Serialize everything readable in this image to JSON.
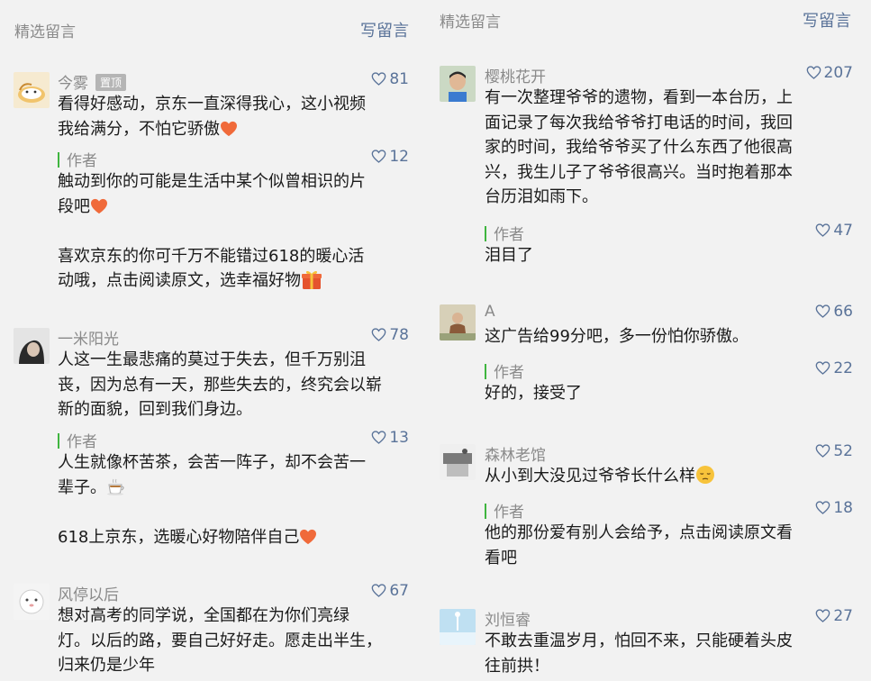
{
  "left": {
    "section_label": "精选留言",
    "write_label": "写留言",
    "comments": [
      {
        "name": "今雾",
        "pin_label": "置顶",
        "likes": "81",
        "lines": [
          "看得好感动，京东一直深得我心，这小视频",
          "我给满分，不怕它骄傲"
        ],
        "reply": {
          "author_label": "作者",
          "likes": "12",
          "lines": [
            "触动到你的可能是生活中某个似曾相识的片",
            "段吧",
            "",
            "喜欢京东的你可千万不能错过618的暖心活",
            "动哦，点击阅读原文，选幸福好物"
          ]
        }
      },
      {
        "name": "一米阳光",
        "likes": "78",
        "lines": [
          "人这一生最悲痛的莫过于失去，但千万别沮",
          "丧，因为总有一天，那些失去的，终究会以崭",
          "新的面貌，回到我们身边。"
        ],
        "reply": {
          "author_label": "作者",
          "likes": "13",
          "lines": [
            "人生就像杯苦茶，会苦一阵子，却不会苦一",
            "辈子。",
            "",
            "618上京东，选暖心好物陪伴自己"
          ]
        }
      },
      {
        "name": "风停以后",
        "likes": "67",
        "lines": [
          "想对高考的同学说，全国都在为你们亮绿",
          "灯。以后的路，要自己好好走。愿走出半生，",
          "归来仍是少年"
        ]
      }
    ]
  },
  "right": {
    "section_label": "精选留言",
    "write_label": "写留言",
    "comments": [
      {
        "name": "樱桃花开",
        "likes": "207",
        "lines": [
          "有一次整理爷爷的遗物，看到一本台历，上",
          "面记录了每次我给爷爷打电话的时间，我回",
          "家的时间，我给爷爷买了什么东西了他很高",
          "兴，我生儿子了爷爷很高兴。当时抱着那本",
          "台历泪如雨下。"
        ],
        "reply": {
          "author_label": "作者",
          "likes": "47",
          "lines": [
            "泪目了"
          ]
        }
      },
      {
        "name": "A",
        "likes": "66",
        "lines": [
          "这广告给99分吧，多一份怕你骄傲。"
        ],
        "reply": {
          "author_label": "作者",
          "likes": "22",
          "lines": [
            "好的，接受了"
          ]
        }
      },
      {
        "name": "森林老馆",
        "likes": "52",
        "lines": [
          "从小到大没见过爷爷长什么样"
        ],
        "reply": {
          "author_label": "作者",
          "likes": "18",
          "lines": [
            "他的那份爱有别人会给予，点击阅读原文看",
            "看吧"
          ]
        }
      },
      {
        "name": "刘恒睿",
        "likes": "27",
        "lines": [
          "不敢去重温岁月，怕回不来，只能硬着头皮",
          "往前拱！"
        ]
      }
    ]
  },
  "colors": {
    "link": "#5a7399",
    "muted": "#8a8a8a",
    "author_bar": "#3fb53f",
    "background": "#f2f2f2"
  },
  "icons": [
    "heart-outline-icon",
    "red-heart-emoji",
    "gift-emoji",
    "tea-emoji",
    "pensive-face-emoji"
  ]
}
